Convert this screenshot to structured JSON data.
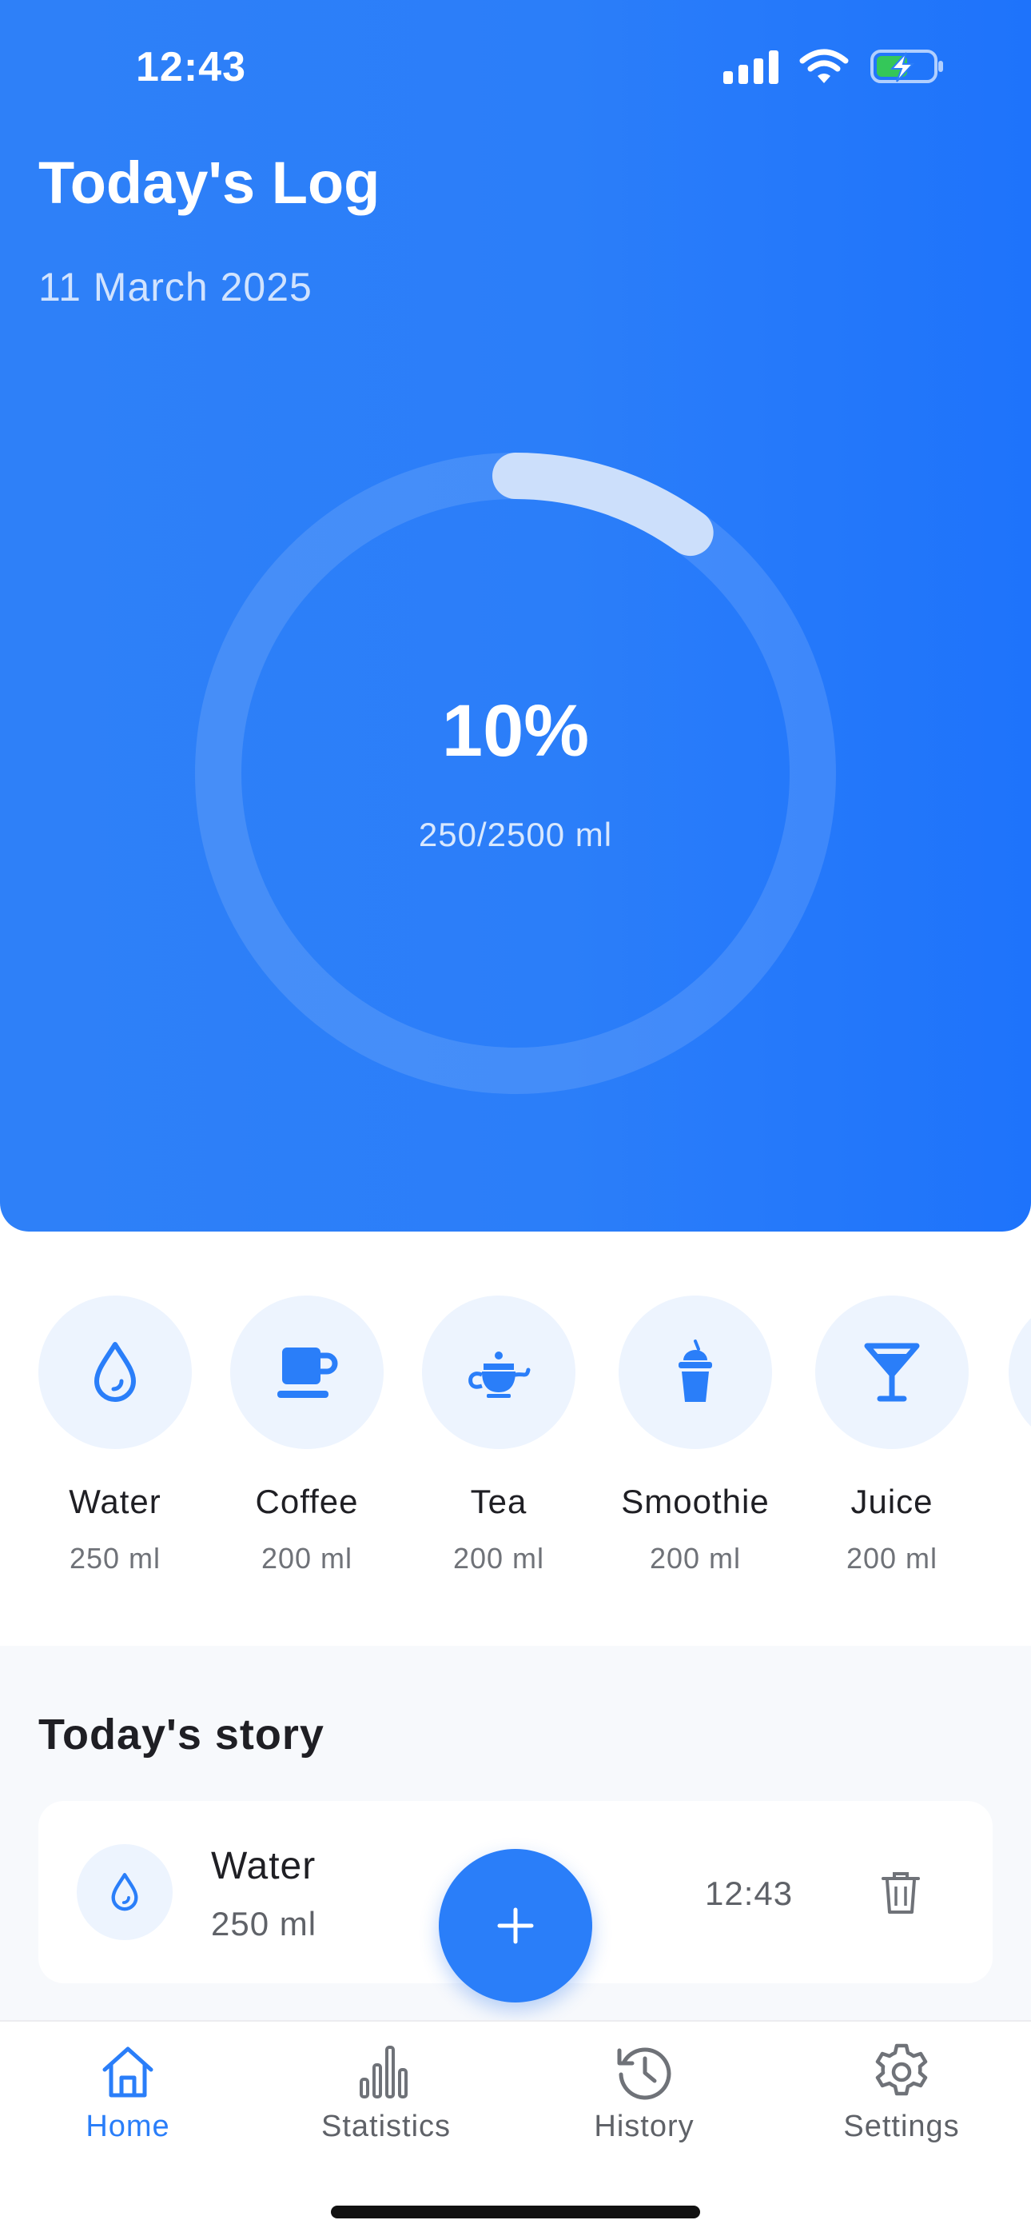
{
  "status_bar": {
    "time": "12:43"
  },
  "header": {
    "title": "Today's Log",
    "date": "11 March 2025"
  },
  "progress": {
    "percent_label": "10%",
    "amount_label": "250/2500 ml",
    "fraction": 0.1
  },
  "drinks": [
    {
      "name": "Water",
      "amount": "250 ml",
      "icon": "water-drop-icon"
    },
    {
      "name": "Coffee",
      "amount": "200 ml",
      "icon": "coffee-cup-icon"
    },
    {
      "name": "Tea",
      "amount": "200 ml",
      "icon": "teapot-icon"
    },
    {
      "name": "Smoothie",
      "amount": "200 ml",
      "icon": "smoothie-cup-icon"
    },
    {
      "name": "Juice",
      "amount": "200 ml",
      "icon": "cocktail-glass-icon"
    }
  ],
  "story": {
    "title": "Today's story",
    "entries": [
      {
        "name": "Water",
        "amount": "250 ml",
        "time": "12:43",
        "icon": "water-drop-icon"
      }
    ]
  },
  "fab": {
    "icon": "plus-icon"
  },
  "nav": {
    "items": [
      {
        "label": "Home",
        "icon": "home-icon",
        "active": true
      },
      {
        "label": "Statistics",
        "icon": "bar-chart-icon",
        "active": false
      },
      {
        "label": "History",
        "icon": "history-icon",
        "active": false
      },
      {
        "label": "Settings",
        "icon": "gear-icon",
        "active": false
      }
    ]
  },
  "colors": {
    "primary": "#2a7ef9",
    "hero_gradient_start": "#2e80f8",
    "hero_gradient_end": "#1e73fb",
    "icon_background": "#edf4fe",
    "battery_green": "#34c759",
    "text_dark": "#1f1f24",
    "text_muted": "#6f7278"
  }
}
